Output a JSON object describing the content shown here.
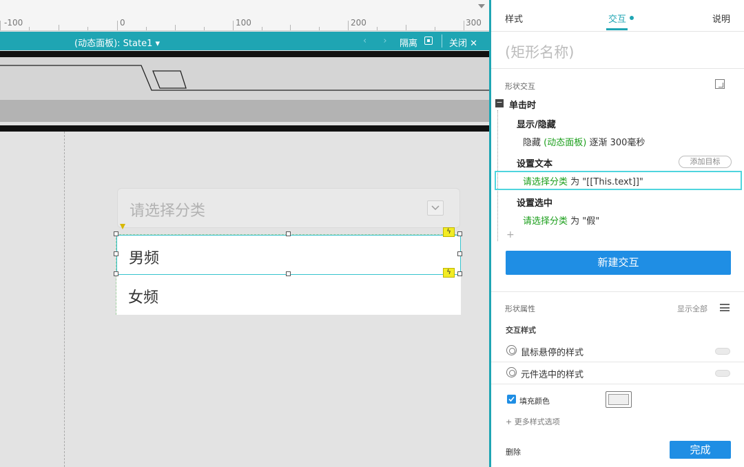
{
  "ruler": {
    "labels": [
      "-100",
      "0",
      "100",
      "200",
      "300"
    ]
  },
  "panel_bar": {
    "state": "(动态面板): State1 ▾",
    "nav": "‹ ›",
    "isolate": "隔离",
    "close": "关闭 ✕"
  },
  "canvas": {
    "dropdown_placeholder": "请选择分类",
    "options": [
      "男频",
      "女频"
    ],
    "bolt_glyph": "ϟ"
  },
  "inspector": {
    "tabs": {
      "style": "样式",
      "interaction": "交互",
      "notes": "说明"
    },
    "shape_name": "(矩形名称)",
    "shape_interactions_label": "形状交互",
    "event": "单击时",
    "collapse_glyph": "−",
    "actions": {
      "show_hide": {
        "title": "显示/隐藏",
        "verb": "隐藏",
        "target": "(动态面板)",
        "detail": "逐渐 300毫秒"
      },
      "set_text": {
        "title": "设置文本",
        "add_target": "添加目标",
        "target": "请选择分类",
        "detail": "为 \"[[This.text]]\""
      },
      "set_selected": {
        "title": "设置选中",
        "target": "请选择分类",
        "detail": "为 \"假\""
      },
      "add_glyph": "+"
    },
    "new_interaction": "新建交互",
    "shape_props_label": "形状属性",
    "show_all": "显示全部",
    "interaction_styles_label": "交互样式",
    "hover_style": "鼠标悬停的样式",
    "selected_style": "元件选中的样式",
    "fill_color_label": "填充颜色",
    "more_styles": "+ 更多样式选项",
    "delete": "删除",
    "done": "完成"
  },
  "colors": {
    "accent": "#1fa5b3",
    "primary_button": "#1f8ee4",
    "link_green": "#1a9e1a",
    "selection": "#4fd5de"
  }
}
